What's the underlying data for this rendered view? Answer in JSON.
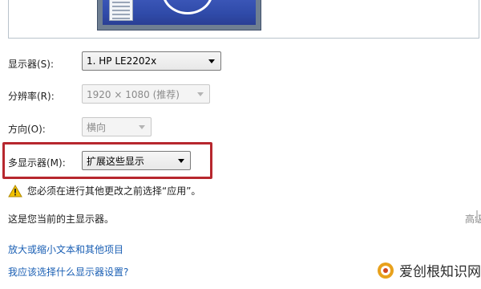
{
  "preview": {
    "icon": "monitor-preview-icon"
  },
  "display_row": {
    "label": "显示器(S):",
    "selected": "1. HP LE2202x"
  },
  "resolution_row": {
    "label": "分辨率(R):",
    "selected": "1920 × 1080 (推荐)"
  },
  "orientation_row": {
    "label": "方向(O):",
    "selected": "横向"
  },
  "multi_display_row": {
    "label": "多显示器(M):",
    "selected": "扩展这些显示"
  },
  "warning": {
    "icon": "warning-icon",
    "text": "您必须在进行其他更改之前选择“应用”。"
  },
  "main_display_text": "这是您当前的主显示器。",
  "advanced_link": "高级",
  "links": {
    "enlarge_text": "放大或缩小文本和其他项目",
    "which_settings": "我应该选择什么显示器设置?"
  },
  "watermark": {
    "icon": "logo-icon",
    "text": "爱创根知识网"
  },
  "colors": {
    "highlight": "#b7272e",
    "link": "#1a5fb4",
    "warning": "#f2c200"
  }
}
